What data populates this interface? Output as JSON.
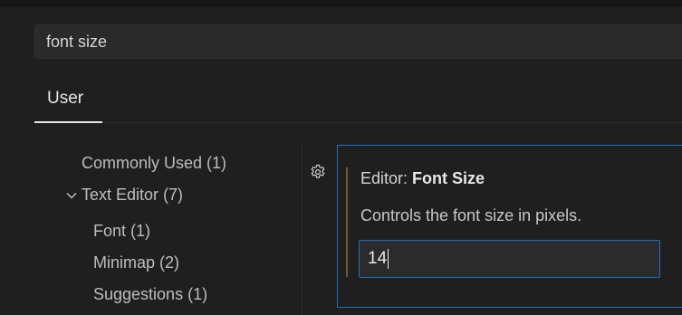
{
  "search": {
    "value": "font size"
  },
  "tabs": [
    {
      "label": "User"
    }
  ],
  "toc": {
    "items": [
      {
        "label": "Commonly Used (1)"
      },
      {
        "label": "Text Editor (7)",
        "icon": "chevron-down-icon"
      },
      {
        "label": "Font (1)"
      },
      {
        "label": "Minimap (2)"
      },
      {
        "label": "Suggestions (1)"
      }
    ]
  },
  "setting": {
    "category": "Editor: ",
    "name": "Font Size",
    "description": "Controls the font size in pixels.",
    "value": "14",
    "icon": "gear-icon"
  },
  "colors": {
    "accent": "#1f6fc5",
    "background": "#1f1f1f",
    "modified": "#6e5c2e"
  }
}
